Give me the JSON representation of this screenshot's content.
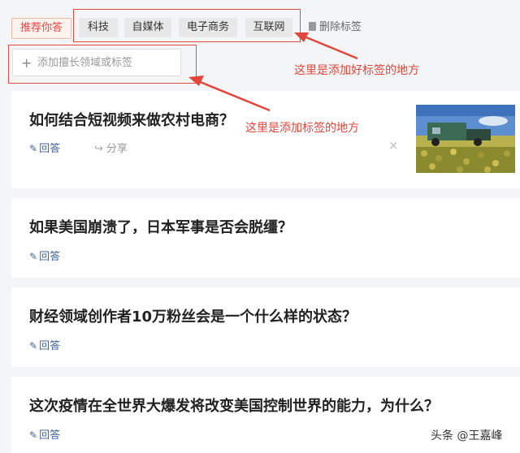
{
  "tags": {
    "recommend": "推荐你答",
    "items": [
      "科技",
      "自媒体",
      "电子商务",
      "互联网"
    ],
    "delete_label": "删除标签"
  },
  "add_input": {
    "placeholder": "添加擅长领域或标签"
  },
  "annotations": {
    "note1": "这里是添加好标签的地方",
    "note2": "这里是添加标签的地方"
  },
  "questions": [
    {
      "title": "如何结合短视频来做农村电商？",
      "answer": "回答",
      "share": "分享",
      "close": "×"
    },
    {
      "title": "如果美国崩溃了，日本军事是否会脱缰？",
      "answer": "回答"
    },
    {
      "title": "财经领域创作者10万粉丝会是一个什么样的状态？",
      "answer": "回答"
    },
    {
      "title": "这次疫情在全世界大爆发将改变美国控制世界的能力，为什么？",
      "answer": "回答"
    }
  ],
  "icons": {
    "edit": "pencil-icon",
    "share": "share-icon",
    "delete": "trash-icon",
    "add": "plus-icon"
  },
  "colors": {
    "accent": "#f04142",
    "link": "#406599",
    "annotation": "#e0463b"
  },
  "watermark": "头条 @王嘉峰"
}
